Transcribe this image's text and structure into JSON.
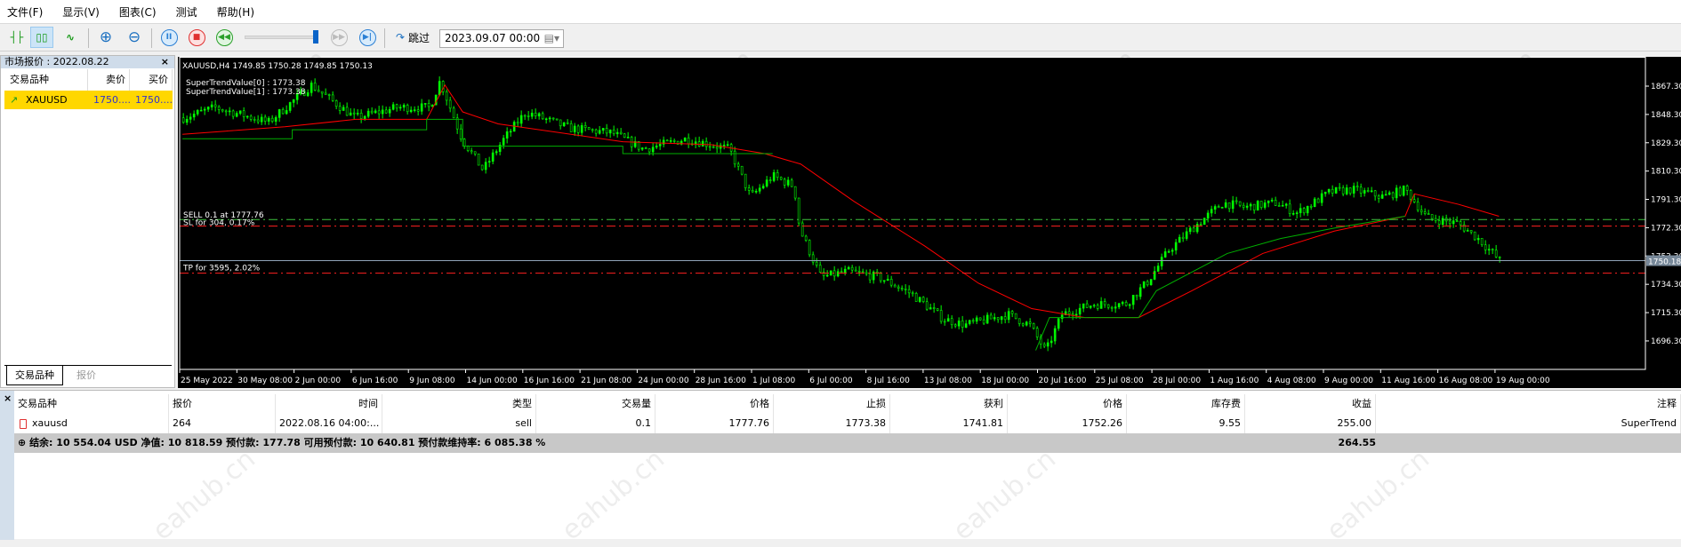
{
  "menu": [
    "文件(F)",
    "显示(V)",
    "图表(C)",
    "测试",
    "帮助(H)"
  ],
  "toolbar": {
    "skip_label": "跳过",
    "date_value": "2023.09.07 00:00"
  },
  "market_watch": {
    "title": "市场报价 : 2022.08.22",
    "close": "×",
    "headers": [
      "交易品种",
      "卖价",
      "买价"
    ],
    "rows": [
      {
        "symbol": "XAUUSD",
        "bid": "1750....",
        "ask": "1750...."
      }
    ],
    "tabs": [
      "交易品种",
      "报价"
    ]
  },
  "chart": {
    "header": "XAUUSD,H4  1749.85 1750.28 1749.85 1750.13",
    "indicator_lines": [
      "SuperTrendValue[0] : 1773.38",
      "SuperTrendValue[1] : 1773.38"
    ],
    "labels": {
      "sell": "SELL 0.1 at 1777.76",
      "sl": "SL for 304, 0.17%",
      "tp": "TP for 3595, 2.02%"
    },
    "current_price": "1750.18",
    "colors": {
      "candle": "#00ff00",
      "red_line": "#ff0000",
      "green_line": "#00b000",
      "grid": "#ffffff"
    }
  },
  "chart_data": {
    "type": "candlestick",
    "symbol": "XAUUSD",
    "timeframe": "H4",
    "y_ticks": [
      1867.3,
      1848.3,
      1829.3,
      1810.3,
      1791.3,
      1772.3,
      1753.3,
      1734.3,
      1715.3,
      1696.3
    ],
    "x_ticks": [
      "25 May 2022",
      "30 May 08:00",
      "2 Jun 00:00",
      "6 Jun 16:00",
      "9 Jun 08:00",
      "14 Jun 00:00",
      "16 Jun 16:00",
      "21 Jun 08:00",
      "24 Jun 00:00",
      "28 Jun 16:00",
      "1 Jul 08:00",
      "6 Jul 00:00",
      "8 Jul 16:00",
      "13 Jul 08:00",
      "18 Jul 00:00",
      "20 Jul 16:00",
      "25 Jul 08:00",
      "28 Jul 00:00",
      "1 Aug 16:00",
      "4 Aug 08:00",
      "9 Aug 00:00",
      "11 Aug 16:00",
      "16 Aug 08:00",
      "19 Aug 00:00"
    ],
    "levels": {
      "sell_open": 1777.76,
      "stop_loss": 1773.38,
      "take_profit": 1741.81,
      "current": 1750.18
    },
    "close_path": [
      [
        0.08,
        1846
      ],
      [
        0.64,
        1853
      ],
      [
        1.57,
        1843
      ],
      [
        2.32,
        1868
      ],
      [
        3.08,
        1846
      ],
      [
        3.83,
        1853
      ],
      [
        4.39,
        1853
      ],
      [
        4.57,
        1871
      ],
      [
        4.95,
        1832
      ],
      [
        5.32,
        1811
      ],
      [
        5.69,
        1832
      ],
      [
        6.07,
        1850
      ],
      [
        6.83,
        1839
      ],
      [
        7.57,
        1836
      ],
      [
        8.13,
        1825
      ],
      [
        8.88,
        1832
      ],
      [
        9.63,
        1825
      ],
      [
        10.0,
        1793
      ],
      [
        10.39,
        1807
      ],
      [
        10.76,
        1800
      ],
      [
        10.86,
        1771
      ],
      [
        11.23,
        1739
      ],
      [
        11.7,
        1743
      ],
      [
        12.25,
        1739
      ],
      [
        12.81,
        1728
      ],
      [
        13.37,
        1711
      ],
      [
        13.75,
        1707
      ],
      [
        14.5,
        1714
      ],
      [
        14.88,
        1707
      ],
      [
        15.16,
        1689
      ],
      [
        15.44,
        1714
      ],
      [
        16.0,
        1721
      ],
      [
        16.56,
        1721
      ],
      [
        16.94,
        1736
      ],
      [
        17.31,
        1757
      ],
      [
        17.7,
        1771
      ],
      [
        18.26,
        1789
      ],
      [
        18.63,
        1786
      ],
      [
        19.19,
        1789
      ],
      [
        19.56,
        1782
      ],
      [
        20.12,
        1796
      ],
      [
        20.5,
        1798
      ],
      [
        21.06,
        1793
      ],
      [
        21.45,
        1798
      ],
      [
        21.82,
        1779
      ],
      [
        22.38,
        1775
      ],
      [
        22.75,
        1764
      ],
      [
        23.1,
        1750
      ]
    ],
    "red_line": [
      [
        0.08,
        1835
      ],
      [
        1.87,
        1840
      ],
      [
        3.11,
        1845
      ],
      [
        4.35,
        1845
      ],
      [
        4.67,
        1868
      ],
      [
        4.98,
        1850
      ],
      [
        5.6,
        1842
      ],
      [
        7.78,
        1830
      ],
      [
        9.33,
        1828
      ],
      [
        10.26,
        1822
      ],
      [
        10.89,
        1815
      ],
      [
        11.82,
        1790
      ],
      [
        13.06,
        1760
      ],
      [
        14.0,
        1735
      ],
      [
        14.93,
        1718
      ],
      [
        15.86,
        1712
      ],
      [
        16.8,
        1712
      ],
      [
        17.73,
        1730
      ],
      [
        18.97,
        1755
      ],
      [
        20.22,
        1770
      ],
      [
        21.46,
        1780
      ],
      [
        21.62,
        1795
      ],
      [
        22.39,
        1788
      ],
      [
        23.1,
        1780
      ]
    ],
    "green_line": [
      [
        [
          0.08,
          1832
        ],
        [
          2.0,
          1832
        ],
        [
          2.0,
          1838
        ],
        [
          4.35,
          1838
        ],
        [
          4.35,
          1845
        ],
        [
          4.98,
          1845
        ],
        [
          4.98,
          1827
        ],
        [
          7.78,
          1827
        ],
        [
          7.78,
          1822
        ],
        [
          10.4,
          1822
        ]
      ],
      [
        [
          15.0,
          1690
        ],
        [
          15.24,
          1712
        ],
        [
          16.8,
          1712
        ],
        [
          17.11,
          1730
        ],
        [
          18.35,
          1755
        ],
        [
          19.28,
          1765
        ],
        [
          20.22,
          1772
        ],
        [
          21.46,
          1780
        ]
      ]
    ]
  },
  "terminal": {
    "close": "×",
    "headers": [
      "交易品种",
      "报价",
      "时间",
      "类型",
      "交易量",
      "价格",
      "止损",
      "获利",
      "价格",
      "库存费",
      "收益",
      "注释"
    ],
    "rows": [
      [
        "xauusd",
        "264",
        "2022.08.16 04:00:...",
        "sell",
        "0.1",
        "1777.76",
        "1773.38",
        "1741.81",
        "1752.26",
        "9.55",
        "255.00",
        "SuperTrend"
      ]
    ],
    "summary": "结余: 10 554.04 USD  净值: 10 818.59  预付款: 177.78  可用预付款: 10 640.81  预付款维持率: 6 085.38 %",
    "summary_total": "264.55"
  },
  "watermark": "eahub.cn"
}
